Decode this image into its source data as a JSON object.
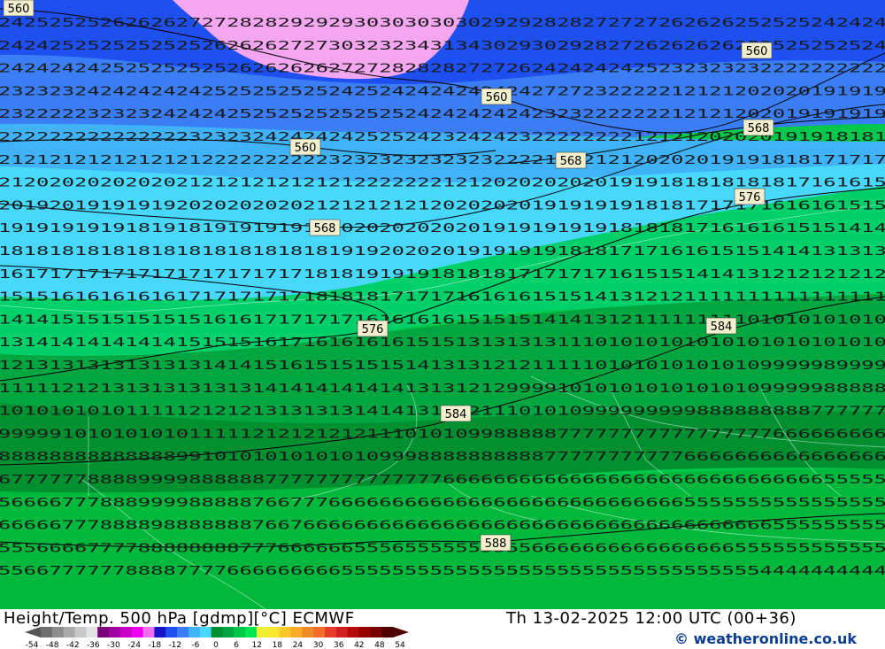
{
  "map": {
    "contour_labels": [
      "560",
      "560",
      "560",
      "560",
      "568",
      "568",
      "568",
      "576",
      "576",
      "584",
      "584",
      "588"
    ],
    "temperature_rows": [
      "2425252526262627272828292929303030303029292828272727262626252525242424",
      "2424252525252525262626272730323234313430293029282726262626252525252524",
      "2424242425252525252626262627272828282727262424242425232323232222222222",
      "2323232424242424252525252524252424242424242727232222212121202020191919",
      "2322222323232424242525252525252524242424242323222222212121202019191919",
      "2222222222222223232324242424252524232424232222222212121202020191918181",
      "2121212121212121222222222232323232323232222121212120202019191818171717",
      "2120202020202021212121212121222222212120202020201919181818181817161615",
      "2019201919191920202020202121212121202020201919191918181717171616161515",
      "1919191919181918191919191920202020202019191919191818181716161615151414",
      "1818181818181818181818181819192020201919191918181717161615151414131313",
      "1617171717171717171717171818191919181818171717171615151414131212121212",
      "1515161616161617171717171818181717171616161515141312121111111111111111",
      "1414151515151515161617171717161616161515151414131211111111101010101010",
      "1314141414141415151516171616161615151313131311101010101010101010101010",
      "1213131313131313141415161515151514131312121111101010101010109999989999",
      "1111121213131313131314141414141413131212999910101010101010109999988888",
      "1010101010111112121213131313141413131211101010999999999888888888777777",
      "9999910101010101111121212121211101010998888877777777777777777666666666",
      "8888888888888899101010101010109998888888888777777777776666666666666666",
      "6777777888899998888887777777777777766666666666666666666666666666655555",
      "5666677788899998888876677766666666666666666666666666665555555555555555",
      "6666677788889888888876676666666666666666666666666666666666666555555555",
      "5556666777788888888777666666555655555555556666666666666666555555555555",
      "5566777777888877776666666665555555555555555555555555555555554444444444"
    ],
    "bands": [
      {
        "color": "#f4a6f0",
        "top": 0.0
      },
      {
        "color": "#1e4ff0",
        "top": 0.0
      },
      {
        "color": "#3a7df5",
        "top": 0.18
      },
      {
        "color": "#3fb2f8",
        "top": 0.3
      },
      {
        "color": "#47d8fb",
        "top": 0.38
      },
      {
        "color": "#00d06a",
        "top": 0.53
      },
      {
        "color": "#00a640",
        "top": 0.64
      },
      {
        "color": "#009030",
        "top": 0.76
      },
      {
        "color": "#00b83c",
        "top": 0.88
      },
      {
        "color": "#00c84a",
        "top": 0.96
      }
    ]
  },
  "footer": {
    "title": "Height/Temp. 500 hPa [gdmp][°C] ECMWF",
    "time": "Th 13-02-2025 12:00 UTC (00+36)",
    "credit": "weatheronline.co.uk",
    "copyright_symbol": "©"
  },
  "scale": {
    "ticks": [
      "-54",
      "-48",
      "-42",
      "-36",
      "-30",
      "-24",
      "-18",
      "-12",
      "-6",
      "0",
      "6",
      "12",
      "18",
      "24",
      "30",
      "36",
      "42",
      "48",
      "54"
    ],
    "colors": [
      "#6e6e6e",
      "#8c8c8c",
      "#aaaaaa",
      "#c8c8c8",
      "#e2e2e2",
      "#7a007a",
      "#a000a0",
      "#c800c8",
      "#f000f0",
      "#f06ef0",
      "#1414c8",
      "#1e4ff0",
      "#3a7df5",
      "#3fb2f8",
      "#47d8fb",
      "#009030",
      "#00a640",
      "#00c84a",
      "#00e650",
      "#f0f032",
      "#f8e632",
      "#f8c828",
      "#f8aa28",
      "#f08c28",
      "#f06e28",
      "#e63c28",
      "#d21e1e",
      "#b40a0a",
      "#960000",
      "#780000",
      "#500000"
    ]
  }
}
